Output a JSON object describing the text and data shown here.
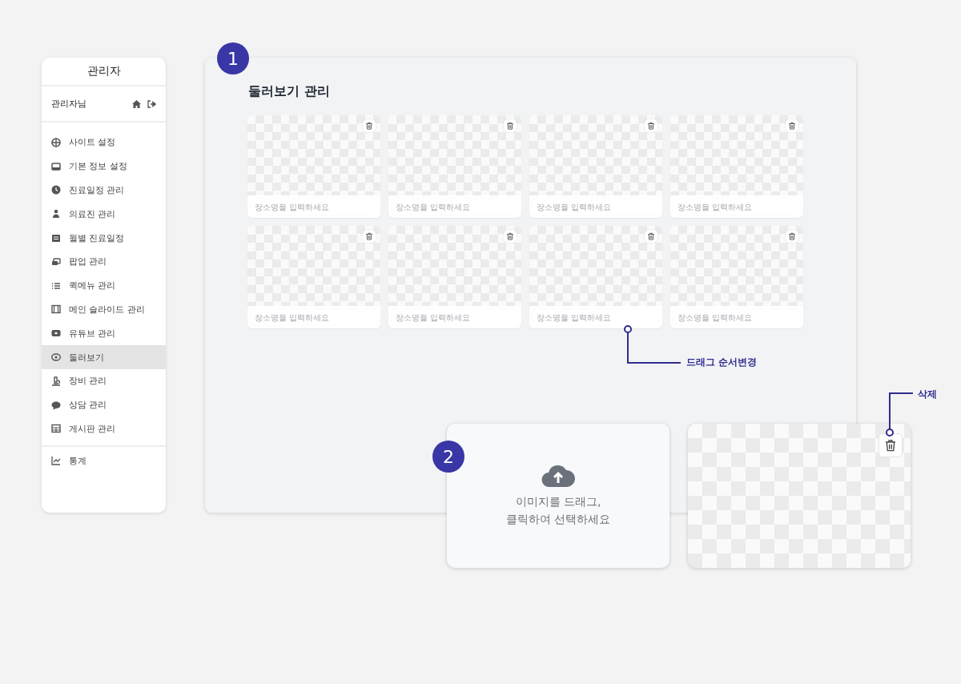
{
  "sidebar": {
    "title": "관리자",
    "user": "관리자님",
    "menu": [
      {
        "label": "사이트 설정",
        "selected": false
      },
      {
        "label": "기본 정보 설정",
        "selected": false
      },
      {
        "label": "진료일정 관리",
        "selected": false
      },
      {
        "label": "의료진 관리",
        "selected": false
      },
      {
        "label": "월별 진료일정",
        "selected": false
      },
      {
        "label": "팝업 관리",
        "selected": false
      },
      {
        "label": "퀵메뉴 관리",
        "selected": false
      },
      {
        "label": "메인 슬라이드 관리",
        "selected": false
      },
      {
        "label": "유튜브 관리",
        "selected": false
      },
      {
        "label": "둘러보기",
        "selected": true
      },
      {
        "label": "장비 관리",
        "selected": false
      },
      {
        "label": "상담 관리",
        "selected": false
      },
      {
        "label": "게시판 관리",
        "selected": false
      }
    ],
    "footer_menu": [
      {
        "label": "통계",
        "selected": false
      }
    ]
  },
  "main": {
    "step": "1",
    "title": "둘러보기 관리",
    "slides": [
      {
        "placeholder": "장소명을 입력하세요"
      },
      {
        "placeholder": "장소명을 입력하세요"
      },
      {
        "placeholder": "장소명을 입력하세요"
      },
      {
        "placeholder": "장소명을 입력하세요"
      },
      {
        "placeholder": "장소명을 입력하세요"
      },
      {
        "placeholder": "장소명을 입력하세요"
      },
      {
        "placeholder": "장소명을 입력하세요"
      },
      {
        "placeholder": "장소명을 입력하세요"
      }
    ]
  },
  "upload": {
    "step": "2",
    "lines": [
      "이미지를 드래그,",
      "클릭하여 선택하세요"
    ]
  },
  "annotations": [
    {
      "kind": "drag",
      "label": "드래그 순서변경"
    },
    {
      "kind": "delete",
      "label": "삭제"
    }
  ]
}
